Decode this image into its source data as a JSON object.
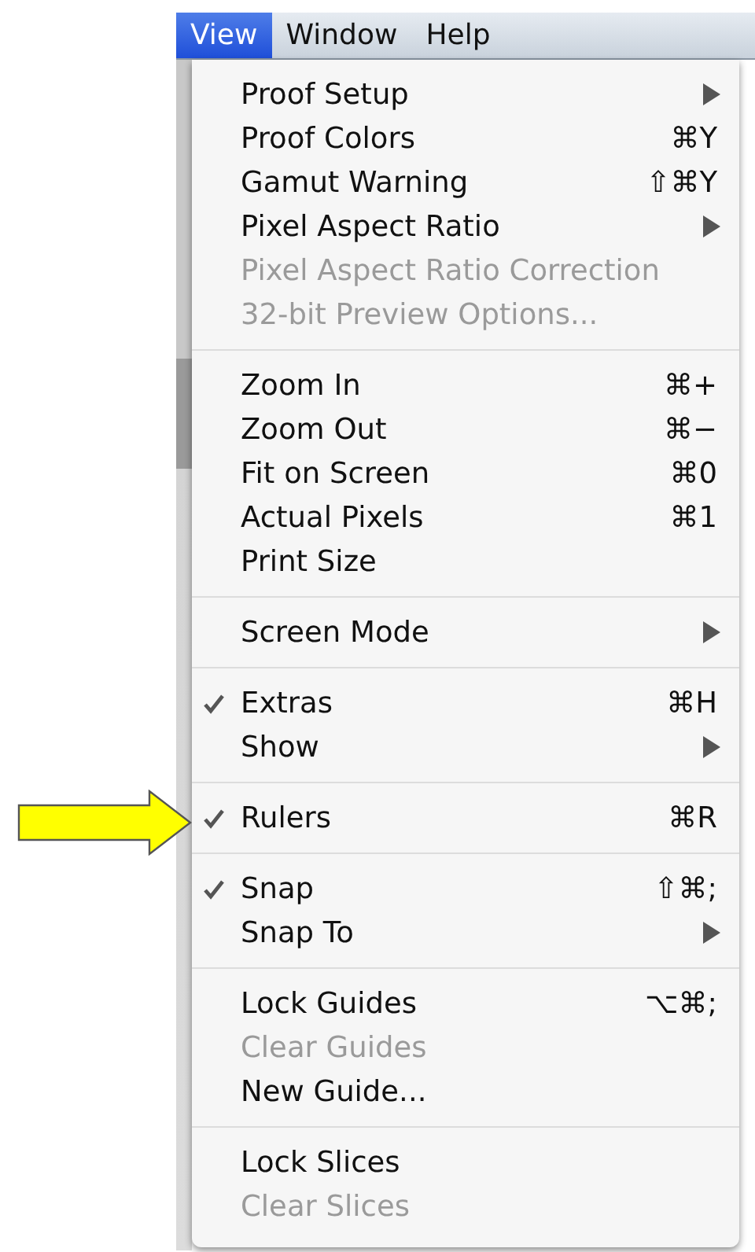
{
  "menubar": [
    {
      "label": "View",
      "selected": true
    },
    {
      "label": "Window",
      "selected": false
    },
    {
      "label": "Help",
      "selected": false
    }
  ],
  "menu": {
    "groups": [
      {
        "items": [
          {
            "label": "Proof Setup",
            "checked": false,
            "disabled": false,
            "submenu": true
          },
          {
            "label": "Proof Colors",
            "shortcut": "⌘Y",
            "checked": false,
            "disabled": false,
            "submenu": false
          },
          {
            "label": "Gamut Warning",
            "shortcut": "⇧⌘Y",
            "checked": false,
            "disabled": false,
            "submenu": false
          },
          {
            "label": "Pixel Aspect Ratio",
            "checked": false,
            "disabled": false,
            "submenu": true
          },
          {
            "label": "Pixel Aspect Ratio Correction",
            "checked": false,
            "disabled": true,
            "submenu": false
          },
          {
            "label": "32-bit Preview Options...",
            "checked": false,
            "disabled": true,
            "submenu": false
          }
        ]
      },
      {
        "items": [
          {
            "label": "Zoom In",
            "shortcut": "⌘+",
            "checked": false,
            "disabled": false,
            "submenu": false
          },
          {
            "label": "Zoom Out",
            "shortcut": "⌘−",
            "checked": false,
            "disabled": false,
            "submenu": false
          },
          {
            "label": "Fit on Screen",
            "shortcut": "⌘0",
            "checked": false,
            "disabled": false,
            "submenu": false
          },
          {
            "label": "Actual Pixels",
            "shortcut": "⌘1",
            "checked": false,
            "disabled": false,
            "submenu": false
          },
          {
            "label": "Print Size",
            "checked": false,
            "disabled": false,
            "submenu": false
          }
        ]
      },
      {
        "items": [
          {
            "label": "Screen Mode",
            "checked": false,
            "disabled": false,
            "submenu": true
          }
        ]
      },
      {
        "items": [
          {
            "label": "Extras",
            "shortcut": "⌘H",
            "checked": true,
            "disabled": false,
            "submenu": false
          },
          {
            "label": "Show",
            "checked": false,
            "disabled": false,
            "submenu": true
          }
        ]
      },
      {
        "items": [
          {
            "label": "Rulers",
            "shortcut": "⌘R",
            "checked": true,
            "disabled": false,
            "submenu": false
          }
        ]
      },
      {
        "items": [
          {
            "label": "Snap",
            "shortcut": "⇧⌘;",
            "checked": true,
            "disabled": false,
            "submenu": false
          },
          {
            "label": "Snap To",
            "checked": false,
            "disabled": false,
            "submenu": true
          }
        ]
      },
      {
        "items": [
          {
            "label": "Lock Guides",
            "shortcut": "⌥⌘;",
            "checked": false,
            "disabled": false,
            "submenu": false
          },
          {
            "label": "Clear Guides",
            "checked": false,
            "disabled": true,
            "submenu": false
          },
          {
            "label": "New Guide...",
            "checked": false,
            "disabled": false,
            "submenu": false
          }
        ]
      },
      {
        "items": [
          {
            "label": "Lock Slices",
            "checked": false,
            "disabled": false,
            "submenu": false
          },
          {
            "label": "Clear Slices",
            "checked": false,
            "disabled": true,
            "submenu": false
          }
        ]
      }
    ]
  }
}
